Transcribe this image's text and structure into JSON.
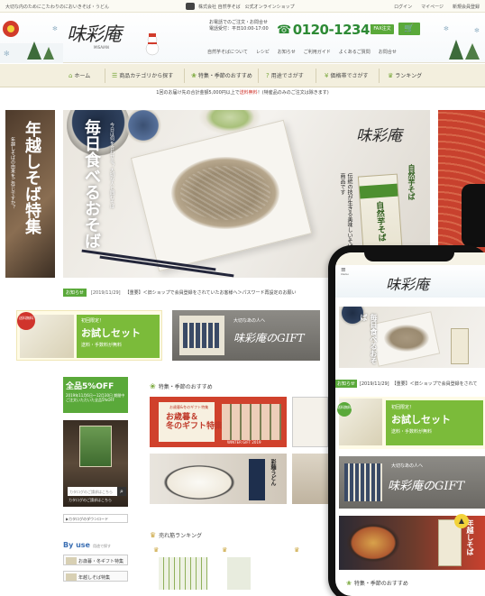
{
  "topbar": {
    "left": "大切な内のためにこたわりのにおいきそば・うどん",
    "center": "株式会社 自然芋そば　公式オンラインショップ",
    "links": [
      "ログイン",
      "マイページ",
      "新規会員登録"
    ]
  },
  "header": {
    "logo": "味彩庵",
    "logo_sub": "MISAIAN",
    "contact_line1": "お電話でのご注文・お問合せ",
    "contact_line2": "電話受付：平日10:00-17:00",
    "phone": "0120-123478",
    "fax_label": "FAX注文",
    "cart_icon": "cart-icon",
    "subnav": [
      "自然芋そばについて",
      "レシピ",
      "お知らせ",
      "ご利用ガイド",
      "よくあるご質問",
      "お問合せ"
    ]
  },
  "gnav": {
    "items": [
      {
        "label": "ホーム",
        "icon": "home-icon"
      },
      {
        "label": "商品カテゴリから探す",
        "icon": "list-icon"
      },
      {
        "label": "特集・季節のおすすめ",
        "icon": "leaf-icon"
      },
      {
        "label": "用途でさがす",
        "icon": "question-icon"
      },
      {
        "label": "価格帯でさがす",
        "icon": "price-icon"
      },
      {
        "label": "ランキング",
        "icon": "crown-icon"
      }
    ]
  },
  "notice": {
    "before": "1回のお届け先の合計金額5,000円以上で",
    "highlight": "送料無料",
    "after": "！(特産品のみのご注文は除きます)"
  },
  "hero_left": {
    "title": "年越しそば特集",
    "sub": "年越しそばの由来をご存じですか？"
  },
  "hero": {
    "headline": "毎日食べるおそば",
    "sub": "今日は何を合わせる？大切な人と囲むそば",
    "brand": "味彩庵",
    "product": "自然芋そば",
    "copy": "伝統の技が生きる美味しいそば ロングラン商品です",
    "side_name": "自然芋そば"
  },
  "news": {
    "tag": "お知らせ",
    "date": "[2019/11/29]",
    "text": "【重要】＜旧ショップで会員登録をされていたお客様へ＞パスワード再設定のお願い"
  },
  "trial": {
    "badge": "送料無料",
    "line1": "初回限定！",
    "line2": "お試しセット",
    "line3": "送料・手数料が無料"
  },
  "gift": {
    "small": "大切なあの人へ",
    "title": "味彩庵のGIFT"
  },
  "coupon": {
    "title": "全品5%OFF",
    "text": "2019年11月6日〜12月30日 期間中ご注文いただいた全品5%OFF"
  },
  "catalog": {
    "placeholder": "カタログのご請求はこちら",
    "caption": "カタログのご請求はこちら",
    "download": "▶カタログのダウンロード"
  },
  "byuse": {
    "title": "By use",
    "sub": "用途で探す",
    "items": [
      "お歳暮・冬ギフト特集",
      "年越しそば特集"
    ]
  },
  "featured": {
    "title": "特集・季節のおすすめ",
    "winter_small": "お歳暮&冬のギフト特集",
    "winter_big_1": "お歳暮＆",
    "winter_big_2": "冬のギフト特集",
    "winter_caption": "WINTER GIFT 2019",
    "udon_label": "彩麺うどん"
  },
  "ranking": {
    "title": "売れ筋ランキング"
  },
  "phone": {
    "menu": "≡",
    "menu_caption": "menu",
    "logo": "味彩庵",
    "hero_headline": "毎日食べるおそば",
    "news_tag": "お知らせ",
    "news_date": "[2019/11/29]",
    "news_text": "【重要】＜旧ショップで会員登録をされて",
    "trial_badge": "送料無料",
    "trial_line1": "初回限定！",
    "trial_line2": "お試しセット",
    "trial_line3": "送料・手数料が無料",
    "gift_small": "大切なあの人へ",
    "gift_title": "味彩庵のGIFT",
    "season_text": "年越しそば",
    "top_label": "▲",
    "section_title": "特集・季節のおすすめ"
  },
  "colors": {
    "accent_green": "#5aa93a",
    "phone_green": "#2d8a35",
    "notice_red": "#d0342c"
  }
}
